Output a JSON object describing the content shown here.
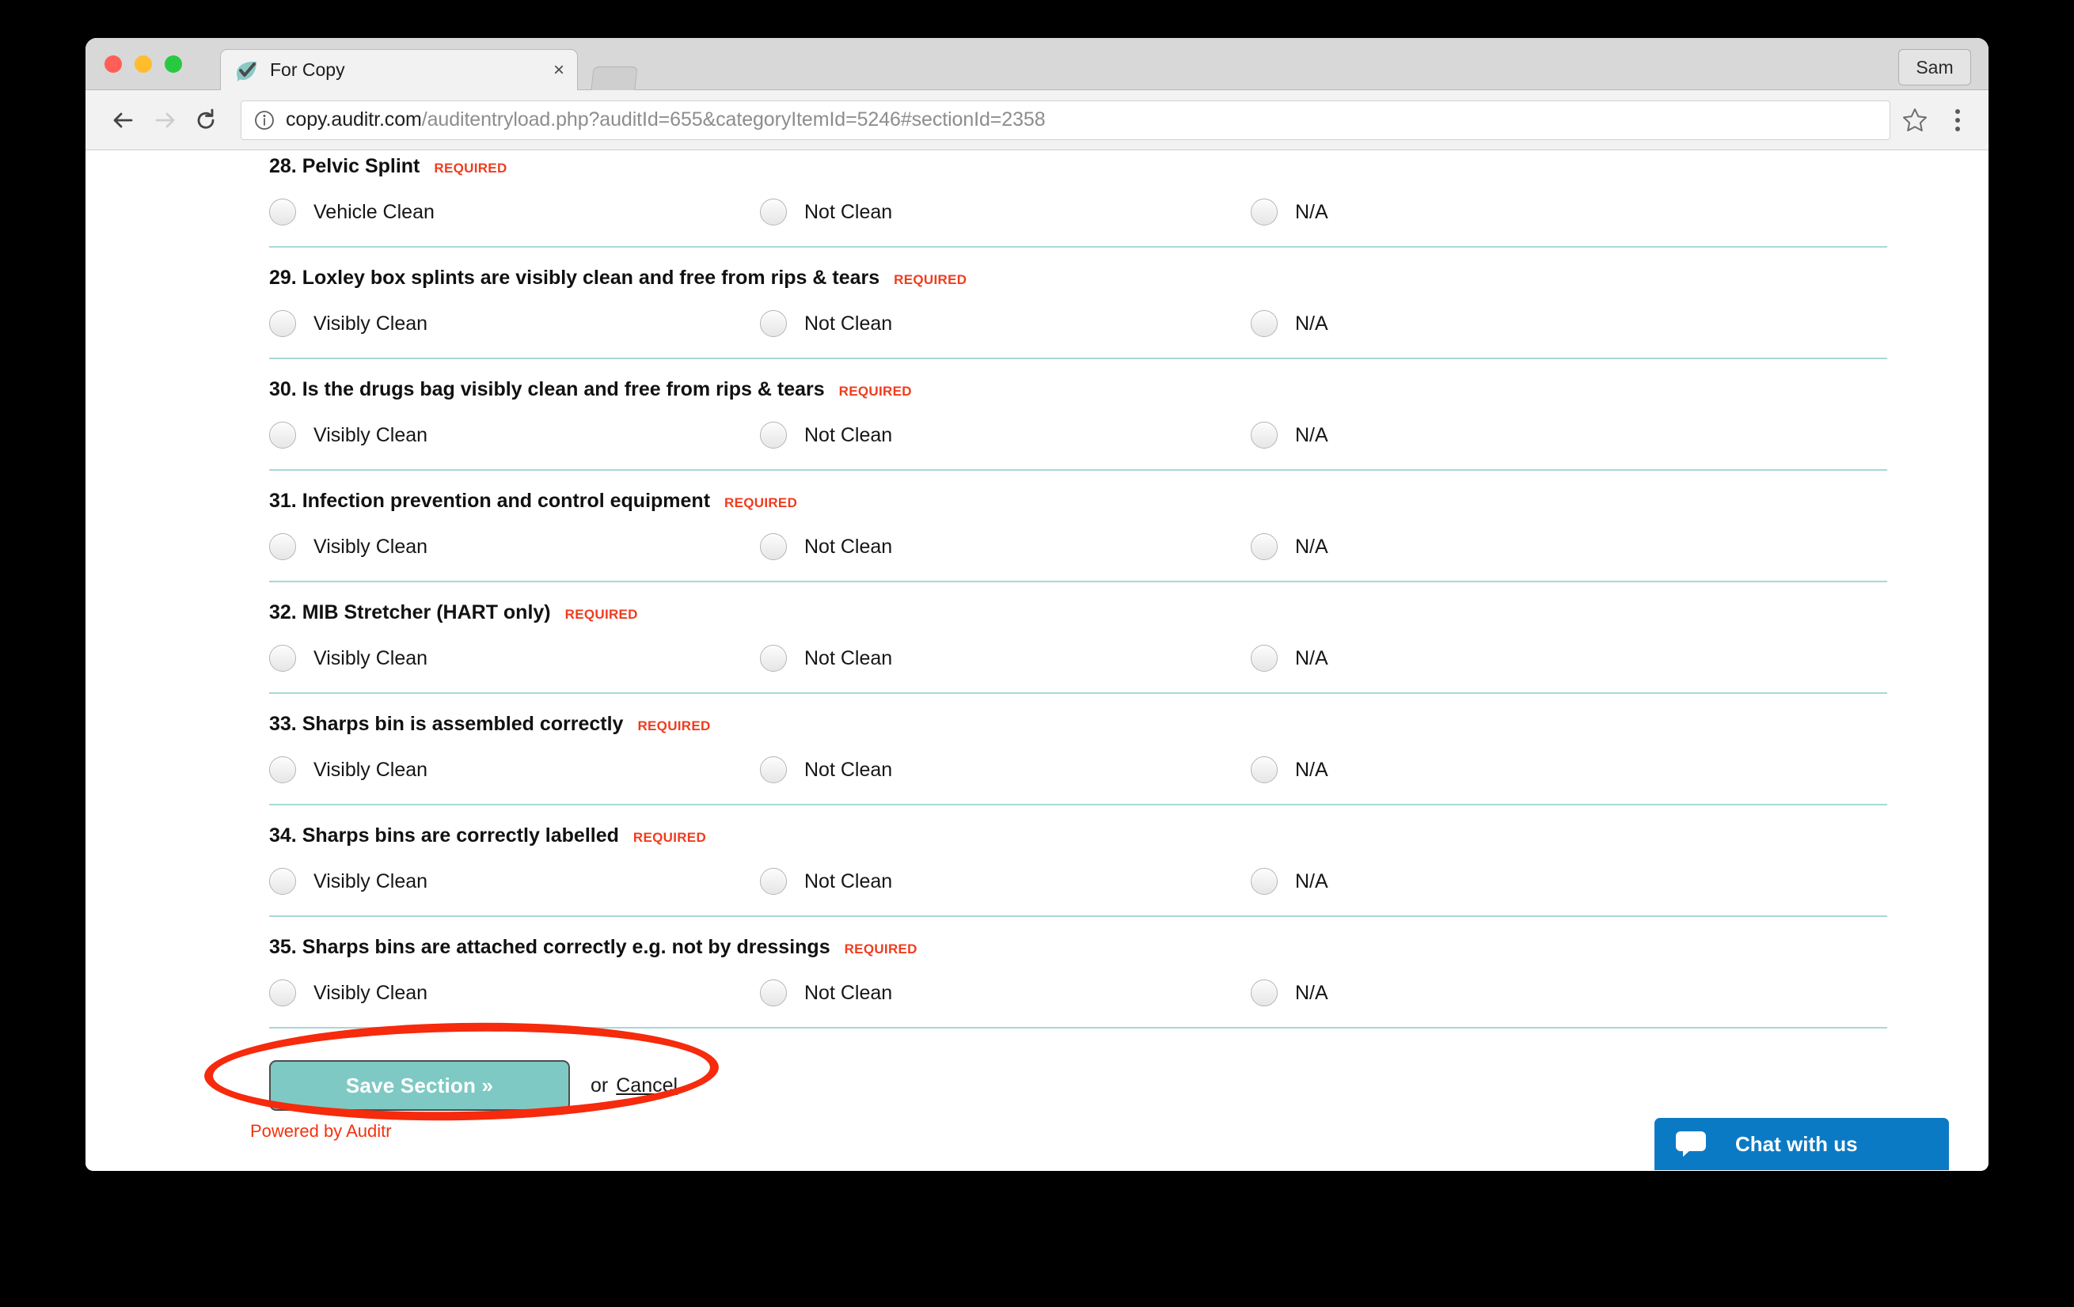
{
  "browser": {
    "tab": {
      "title": "For Copy",
      "favicon": "leaf-check-icon",
      "close": "×"
    },
    "new_tab_label": "+",
    "profile_label": "Sam",
    "nav": {
      "back": "back-arrow-icon",
      "forward": "forward-arrow-icon",
      "reload": "reload-icon"
    },
    "omnibox": {
      "info_icon": "info-circle-icon",
      "host": "copy.auditr.com",
      "path": "/auditentryload.php?auditId=655&categoryItemId=5246#sectionId=2358"
    },
    "bookmark_icon": "star-icon",
    "menu_icon": "three-dots-menu-icon"
  },
  "page": {
    "required_label": "REQUIRED",
    "questions": [
      {
        "number": "28.",
        "text": "Pelvic Splint",
        "required": "REQUIRED",
        "options": [
          "Vehicle Clean",
          "Not Clean",
          "N/A"
        ]
      },
      {
        "number": "29.",
        "text": "Loxley box splints are visibly clean and free from rips & tears",
        "required": "REQUIRED",
        "options": [
          "Visibly Clean",
          "Not Clean",
          "N/A"
        ]
      },
      {
        "number": "30.",
        "text": "Is the drugs bag visibly clean and free from rips & tears",
        "required": "REQUIRED",
        "options": [
          "Visibly Clean",
          "Not Clean",
          "N/A"
        ]
      },
      {
        "number": "31.",
        "text": "Infection prevention and control equipment",
        "required": "REQUIRED",
        "options": [
          "Visibly Clean",
          "Not Clean",
          "N/A"
        ]
      },
      {
        "number": "32.",
        "text": "MIB Stretcher (HART only)",
        "required": "REQUIRED",
        "options": [
          "Visibly Clean",
          "Not Clean",
          "N/A"
        ]
      },
      {
        "number": "33.",
        "text": "Sharps bin is assembled correctly",
        "required": "REQUIRED",
        "options": [
          "Visibly Clean",
          "Not Clean",
          "N/A"
        ]
      },
      {
        "number": "34.",
        "text": "Sharps bins are correctly labelled",
        "required": "REQUIRED",
        "options": [
          "Visibly Clean",
          "Not Clean",
          "N/A"
        ]
      },
      {
        "number": "35.",
        "text": "Sharps bins are attached correctly e.g. not by dressings",
        "required": "REQUIRED",
        "options": [
          "Visibly Clean",
          "Not Clean",
          "N/A"
        ]
      }
    ],
    "actions": {
      "save_label": "Save Section »",
      "or_label": "or",
      "cancel_label": "Cancel"
    },
    "footer": {
      "powered_by": "Powered by Auditr"
    },
    "chat": {
      "label": "Chat with us",
      "icon": "chat-bubble-icon"
    }
  },
  "colors": {
    "accent_teal": "#7fc9c4",
    "divider_teal": "#a8d8d4",
    "required_red": "#f03c1e",
    "annotation_red": "#f62a0c",
    "chat_blue": "#0b7ac4",
    "footer_red": "#f4320c"
  }
}
